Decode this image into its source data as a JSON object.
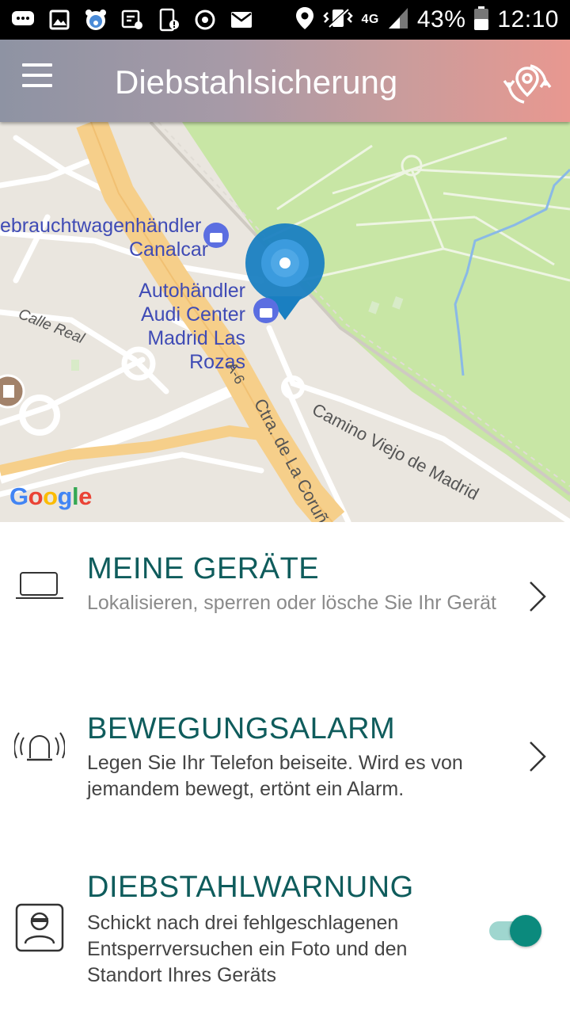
{
  "status_bar": {
    "battery_percent": "43%",
    "time": "12:10",
    "network": "4G"
  },
  "header": {
    "title": "Diebstahlsicherung"
  },
  "map": {
    "pois": [
      {
        "lines": [
          "ebrauchtwagenhändler",
          "Canalcar"
        ]
      },
      {
        "lines": [
          "Autohändler",
          "Audi Center",
          "Madrid Las Rozas"
        ]
      }
    ],
    "streets": {
      "calle_real": "Calle Real",
      "a6": "A-6",
      "ctra": "Ctra. de La Coruña",
      "camino": "Camino Viejo de Madrid"
    },
    "google": [
      "G",
      "o",
      "o",
      "g",
      "l",
      "e"
    ],
    "colors": {
      "park": "#c8e6a5",
      "road_major": "#f6cf8a",
      "marker": "#1a7fc1"
    }
  },
  "items": [
    {
      "title": "MEINE GERÄTE",
      "desc": "Lokalisieren, sperren oder lösche Sie Ihr Gerät",
      "icon": "laptop-icon"
    },
    {
      "title": "BEWEGUNGSALARM",
      "desc": "Legen Sie Ihr Telefon beiseite. Wird es von jemandem bewegt, ertönt ein Alarm.",
      "icon": "alarm-siren-icon"
    },
    {
      "title": "DIEBSTAHLWARNUNG",
      "desc": "Schickt nach drei fehlgeschlagenen Entsperrversuchen ein Foto und den Standort Ihres Geräts",
      "icon": "thief-icon",
      "toggle_on": true
    }
  ],
  "colors": {
    "accent": "#0f5c5c",
    "toggle_on": "#0b8a7d"
  }
}
